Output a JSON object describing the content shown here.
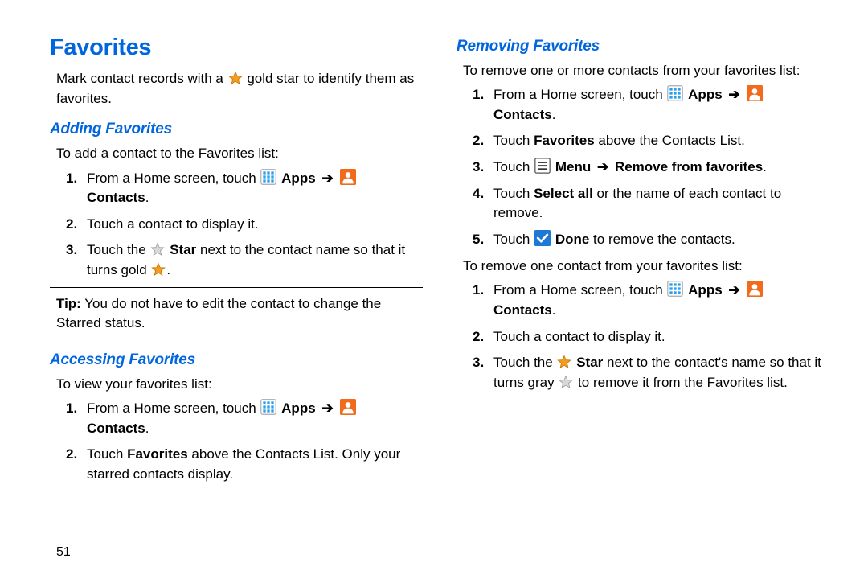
{
  "left": {
    "title": "Favorites",
    "intro_a": "Mark contact records with a ",
    "intro_b": " gold star to identify them as favorites.",
    "adding": {
      "heading": "Adding Favorites",
      "lead": "To add a contact to the Favorites list:",
      "steps": [
        {
          "num": "1.",
          "a": "From a Home screen, touch ",
          "apps": "Apps",
          "arrow": "➔",
          "contacts": "Contacts",
          "tail": "."
        },
        {
          "num": "2.",
          "text": "Touch a contact to display it."
        },
        {
          "num": "3.",
          "a": "Touch the ",
          "star": "Star",
          "b": " next to the contact name so that it turns gold ",
          "tail": "."
        }
      ],
      "tip_label": "Tip:",
      "tip_text": " You do not have to edit the contact to change the Starred status."
    },
    "accessing": {
      "heading": "Accessing Favorites",
      "lead": "To view your favorites list:",
      "steps": [
        {
          "num": "1.",
          "a": "From a Home screen, touch ",
          "apps": "Apps",
          "arrow": "➔",
          "contacts": "Contacts",
          "tail": "."
        },
        {
          "num": "2.",
          "a": "Touch ",
          "fav": "Favorites",
          "b": " above the Contacts List. Only your starred contacts display."
        }
      ]
    }
  },
  "right": {
    "removing": {
      "heading": "Removing Favorites",
      "lead1": "To remove one or more contacts from your favorites list:",
      "stepsA": [
        {
          "num": "1.",
          "a": "From a Home screen, touch ",
          "apps": "Apps",
          "arrow": "➔",
          "contacts": "Contacts",
          "tail": "."
        },
        {
          "num": "2.",
          "a": "Touch ",
          "fav": "Favorites",
          "b": " above the Contacts List."
        },
        {
          "num": "3.",
          "a": "Touch ",
          "menu": "Menu",
          "arrow": "➔",
          "remove": "Remove from favorites",
          "tail": "."
        },
        {
          "num": "4.",
          "a": "Touch ",
          "select": "Select all",
          "b": " or the name of each contact to remove."
        },
        {
          "num": "5.",
          "a": "Touch ",
          "done": "Done",
          "b": " to remove the contacts."
        }
      ],
      "lead2": "To remove one contact from your favorites list:",
      "stepsB": [
        {
          "num": "1.",
          "a": "From a Home screen, touch ",
          "apps": "Apps",
          "arrow": "➔",
          "contacts": "Contacts",
          "tail": "."
        },
        {
          "num": "2.",
          "text": "Touch a contact to display it."
        },
        {
          "num": "3.",
          "a": "Touch the ",
          "star": "Star",
          "b": " next to the contact's name so that it turns gray ",
          "c": " to remove it from the Favorites list."
        }
      ]
    }
  },
  "pagenum": "51"
}
